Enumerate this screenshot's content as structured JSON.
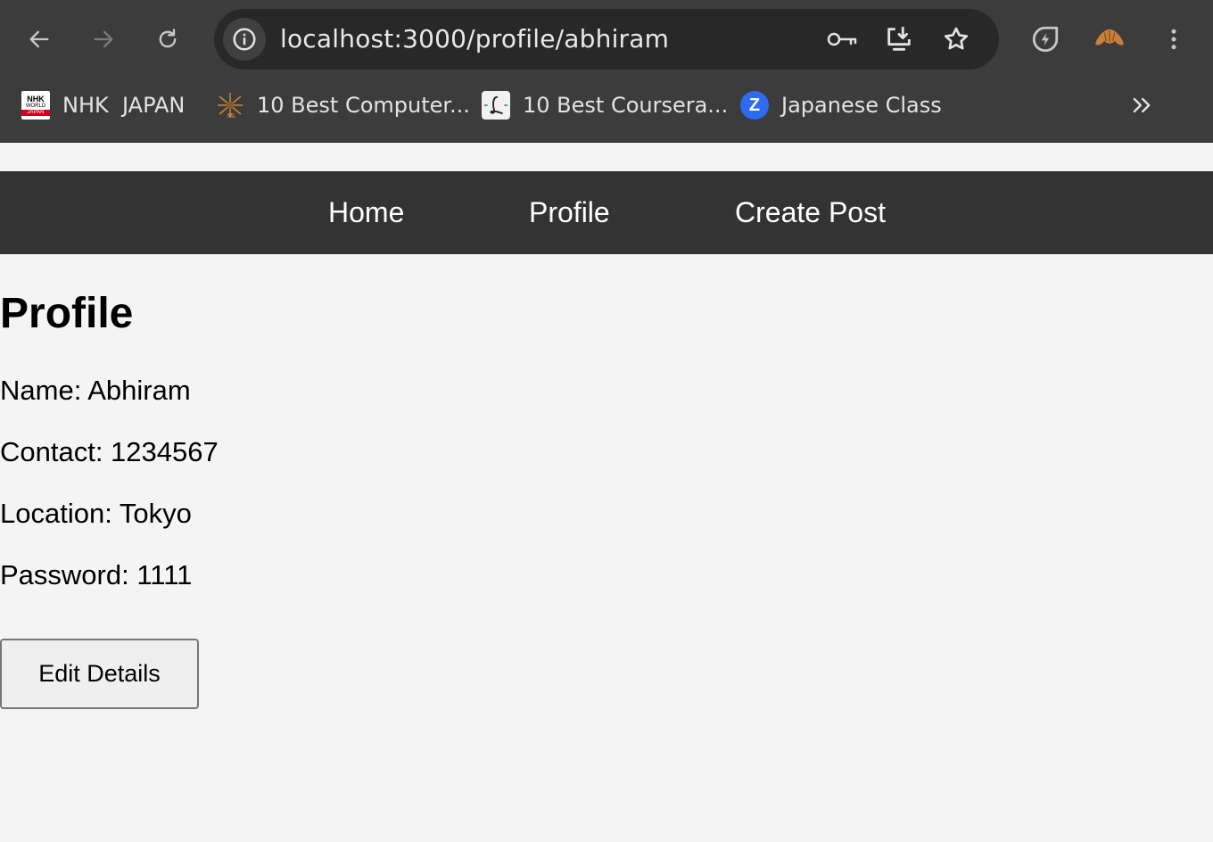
{
  "browser": {
    "url": "localhost:3000/profile/abhiram",
    "bookmarks": [
      {
        "label": "NHK  JAPAN",
        "icon": "nhk-world-icon"
      },
      {
        "label": "10 Best Computer...",
        "icon": "ml-icon"
      },
      {
        "label": "10 Best Coursera...",
        "icon": "l-bookmark-icon"
      },
      {
        "label": "Japanese Class",
        "icon": "zoom-icon"
      }
    ],
    "colors": {
      "chrome_bg": "#3c3c3c",
      "omnibox_bg": "#282828",
      "text": "#e8e8e8"
    }
  },
  "navbar": {
    "links": [
      {
        "label": "Home"
      },
      {
        "label": "Profile"
      },
      {
        "label": "Create Post"
      }
    ],
    "colors": {
      "bg": "#333333",
      "text": "#ffffff"
    }
  },
  "profile": {
    "title": "Profile",
    "fields": [
      {
        "text": "Name: Abhiram"
      },
      {
        "text": "Contact: 1234567"
      },
      {
        "text": "Location: Tokyo"
      },
      {
        "text": "Password: 1111"
      }
    ],
    "edit_button_label": "Edit Details"
  },
  "page": {
    "background": "#f4f4f4"
  }
}
